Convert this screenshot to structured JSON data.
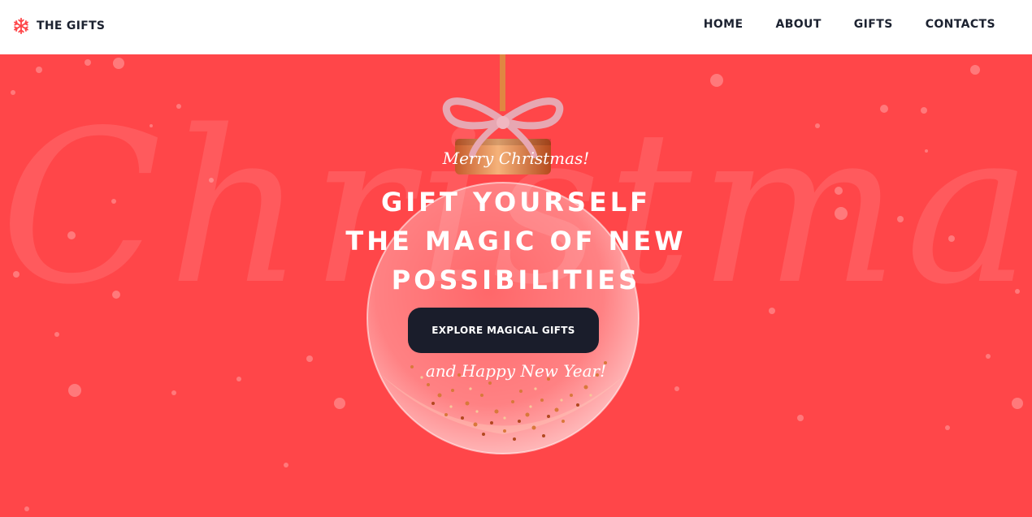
{
  "header": {
    "logo_text": "THE GIFTS",
    "logo_icon": "snowflake-icon",
    "nav": [
      "HOME",
      "ABOUT",
      "GIFTS",
      "CONTACTS"
    ]
  },
  "hero": {
    "background_text": "Christmas",
    "greeting_top": "Merry Christmas!",
    "headline_lines": [
      "GIFT YOURSELF",
      "THE MAGIC OF NEW",
      "POSSIBILITIES"
    ],
    "cta_label": "EXPLORE MAGICAL GIFTS",
    "greeting_bottom": "and Happy New Year!"
  },
  "colors": {
    "hero_bg": "#ff4649",
    "button_bg": "#1a1d2b",
    "text_dark": "#1c2230",
    "accent": "#ff4649"
  }
}
